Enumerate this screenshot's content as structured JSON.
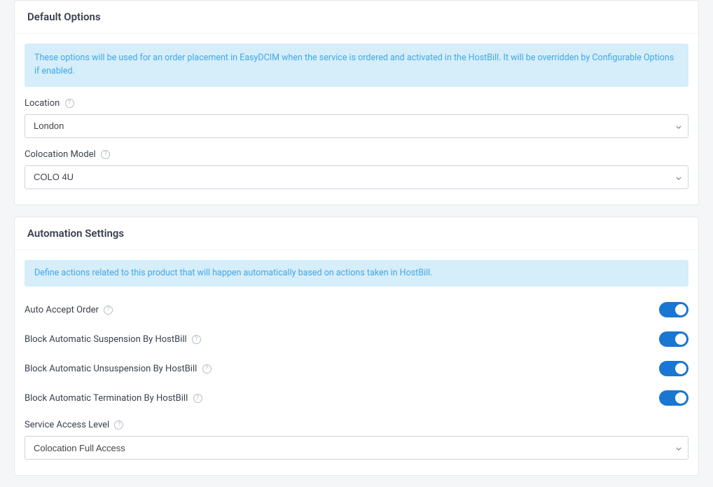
{
  "default_options": {
    "title": "Default Options",
    "info": "These options will be used for an order placement in EasyDCIM when the service is ordered and activated in the HostBill. It will be overridden by Configurable Options if enabled.",
    "location": {
      "label": "Location",
      "value": "London"
    },
    "colocation_model": {
      "label": "Colocation Model",
      "value": "COLO 4U"
    }
  },
  "automation_settings": {
    "title": "Automation Settings",
    "info": "Define actions related to this product that will happen automatically based on actions taken in HostBill.",
    "auto_accept_order": {
      "label": "Auto Accept Order",
      "enabled": true
    },
    "block_auto_suspension": {
      "label": "Block Automatic Suspension By HostBill",
      "enabled": true
    },
    "block_auto_unsuspension": {
      "label": "Block Automatic Unsuspension By HostBill",
      "enabled": true
    },
    "block_auto_termination": {
      "label": "Block Automatic Termination By HostBill",
      "enabled": true
    },
    "service_access_level": {
      "label": "Service Access Level",
      "value": "Colocation Full Access"
    }
  }
}
